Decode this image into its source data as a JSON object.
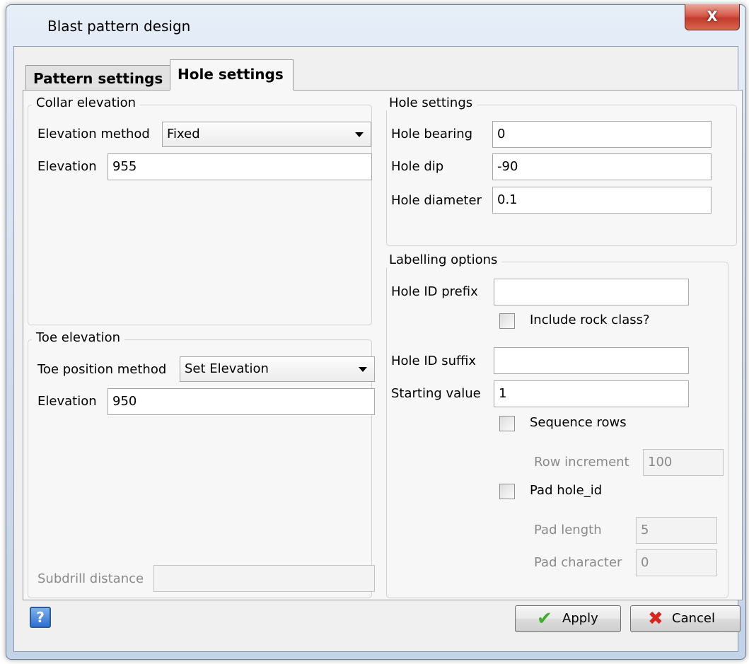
{
  "window": {
    "title": "Blast pattern design",
    "close_glyph": "X"
  },
  "tabs": [
    {
      "label": "Pattern settings",
      "active": false
    },
    {
      "label": "Hole settings",
      "active": true
    }
  ],
  "collar": {
    "title": "Collar elevation",
    "method_label": "Elevation method",
    "method_value": "Fixed",
    "elevation_label": "Elevation",
    "elevation_value": "955"
  },
  "toe": {
    "title": "Toe elevation",
    "method_label": "Toe position method",
    "method_value": "Set Elevation",
    "elevation_label": "Elevation",
    "elevation_value": "950",
    "subdrill_label": "Subdrill distance",
    "subdrill_value": ""
  },
  "hole": {
    "title": "Hole settings",
    "bearing_label": "Hole bearing",
    "bearing_value": "0",
    "dip_label": "Hole dip",
    "dip_value": "-90",
    "diameter_label": "Hole diameter",
    "diameter_value": "0.1"
  },
  "labelling": {
    "title": "Labelling options",
    "prefix_label": "Hole ID prefix",
    "prefix_value": "",
    "rock_class_label": "Include rock class?",
    "rock_class_checked": false,
    "suffix_label": "Hole ID suffix",
    "suffix_value": "",
    "start_label": "Starting value",
    "start_value": "1",
    "seq_rows_label": "Sequence rows",
    "seq_rows_checked": false,
    "row_inc_label": "Row increment",
    "row_inc_value": "100",
    "pad_label": "Pad hole_id",
    "pad_checked": false,
    "pad_length_label": "Pad length",
    "pad_length_value": "5",
    "pad_char_label": "Pad character",
    "pad_char_value": "0"
  },
  "footer": {
    "help_glyph": "?",
    "apply_label": "Apply",
    "apply_icon": "checkmark-icon",
    "cancel_label": "Cancel",
    "cancel_icon": "red-x-icon",
    "apply_color": "#3fae2a",
    "cancel_color": "#d9261c"
  }
}
